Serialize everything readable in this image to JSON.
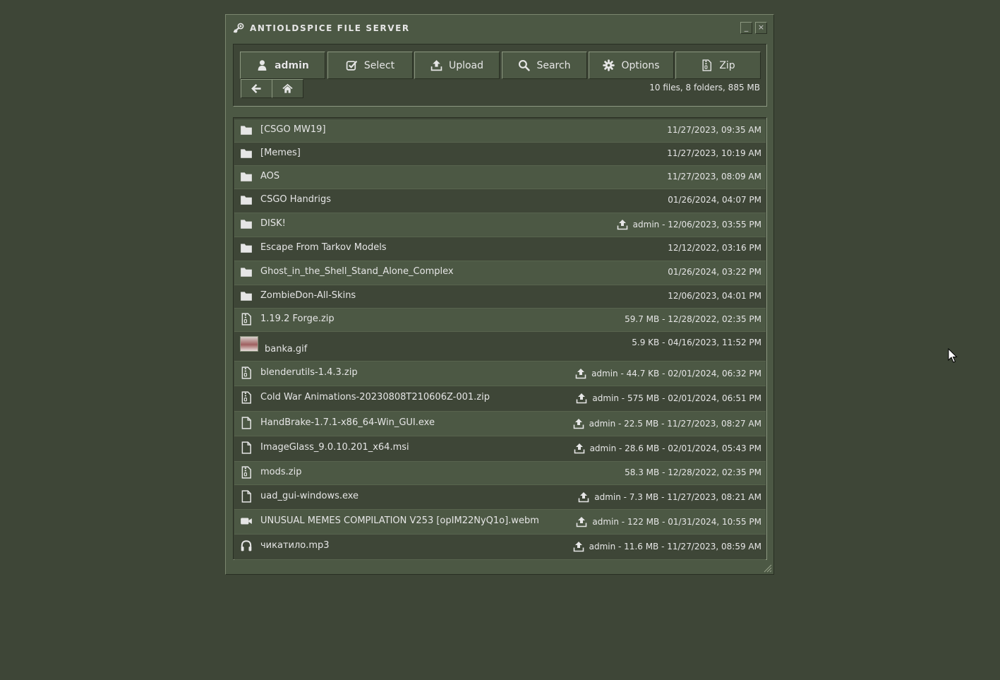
{
  "window": {
    "title": "ANTIOLDSPICE FILE SERVER",
    "minimize_label": "_",
    "close_label": "×"
  },
  "toolbar": {
    "buttons": [
      {
        "label": "admin",
        "icon": "user-icon"
      },
      {
        "label": "Select",
        "icon": "checkbox-icon"
      },
      {
        "label": "Upload",
        "icon": "upload-icon"
      },
      {
        "label": "Search",
        "icon": "search-icon"
      },
      {
        "label": "Options",
        "icon": "gear-icon"
      },
      {
        "label": "Zip",
        "icon": "zip-file-icon"
      }
    ],
    "nav": [
      {
        "icon": "arrow-left-icon"
      },
      {
        "icon": "home-icon"
      }
    ],
    "summary": "10 files, 8 folders, 885 MB"
  },
  "files": [
    {
      "name": "[CSGO MW19]",
      "meta": "11/27/2023, 09:35 AM",
      "icon": "folder-icon",
      "uploaded": false
    },
    {
      "name": "[Memes]",
      "meta": "11/27/2023, 10:19 AM",
      "icon": "folder-icon",
      "uploaded": false
    },
    {
      "name": "AOS",
      "meta": "11/27/2023, 08:09 AM",
      "icon": "folder-icon",
      "uploaded": false
    },
    {
      "name": "CSGO Handrigs",
      "meta": "01/26/2024, 04:07 PM",
      "icon": "folder-icon",
      "uploaded": false
    },
    {
      "name": "DISK!",
      "meta": "admin - 12/06/2023, 03:55 PM",
      "icon": "folder-icon",
      "uploaded": true
    },
    {
      "name": "Escape From Tarkov Models",
      "meta": "12/12/2022, 03:16 PM",
      "icon": "folder-icon",
      "uploaded": false
    },
    {
      "name": "Ghost_in_the_Shell_Stand_Alone_Complex",
      "meta": "01/26/2024, 03:22 PM",
      "icon": "folder-icon",
      "uploaded": false
    },
    {
      "name": "ZombieDon-All-Skins",
      "meta": "12/06/2023, 04:01 PM",
      "icon": "folder-icon",
      "uploaded": false
    },
    {
      "name": "1.19.2 Forge.zip",
      "meta": "59.7 MB - 12/28/2022, 02:35 PM",
      "icon": "zip-file-icon",
      "uploaded": false
    },
    {
      "name": "banka.gif",
      "meta": "5.9 KB - 04/16/2023, 11:52 PM",
      "icon": "image-thumbnail",
      "uploaded": false
    },
    {
      "name": "blenderutils-1.4.3.zip",
      "meta": "admin - 44.7 KB - 02/01/2024, 06:32 PM",
      "icon": "zip-file-icon",
      "uploaded": true
    },
    {
      "name": "Cold War Animations-20230808T210606Z-001.zip",
      "meta": "admin - 575 MB - 02/01/2024, 06:51 PM",
      "icon": "zip-file-icon",
      "uploaded": true
    },
    {
      "name": "HandBrake-1.7.1-x86_64-Win_GUI.exe",
      "meta": "admin - 22.5 MB - 11/27/2023, 08:27 AM",
      "icon": "file-icon",
      "uploaded": true
    },
    {
      "name": "ImageGlass_9.0.10.201_x64.msi",
      "meta": "admin - 28.6 MB - 02/01/2024, 05:43 PM",
      "icon": "file-icon",
      "uploaded": true
    },
    {
      "name": "mods.zip",
      "meta": "58.3 MB - 12/28/2022, 02:35 PM",
      "icon": "zip-file-icon",
      "uploaded": false
    },
    {
      "name": "uad_gui-windows.exe",
      "meta": "admin - 7.3 MB - 11/27/2023, 08:21 AM",
      "icon": "file-icon",
      "uploaded": true
    },
    {
      "name": "UNUSUAL MEMES COMPILATION V253 [opIM22NyQ1o].webm",
      "meta": "admin - 122 MB - 01/31/2024, 10:55 PM",
      "icon": "video-icon",
      "uploaded": true
    },
    {
      "name": "чикатило.mp3",
      "meta": "admin - 11.6 MB - 11/27/2023, 08:59 AM",
      "icon": "headphones-icon",
      "uploaded": true
    }
  ]
}
